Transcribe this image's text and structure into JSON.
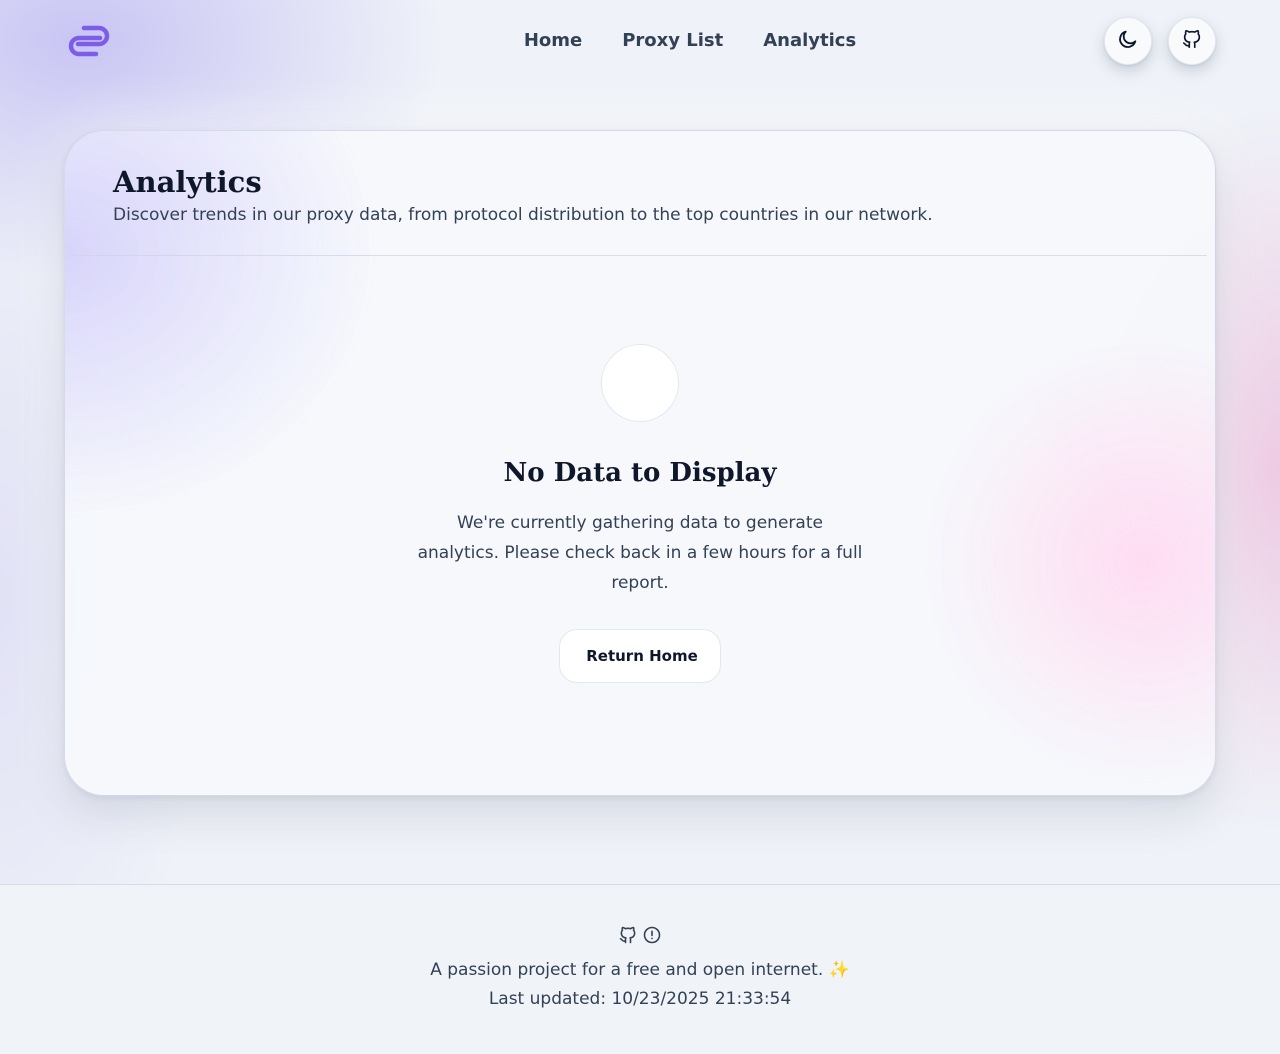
{
  "nav": {
    "links": [
      {
        "label": "Home"
      },
      {
        "label": "Proxy List"
      },
      {
        "label": "Analytics"
      }
    ]
  },
  "icons": {
    "logo": "link-logo-icon",
    "theme_toggle": "moon-icon",
    "github": "github-icon",
    "footer_github": "github-icon",
    "footer_issue": "alert-circle-icon"
  },
  "card": {
    "title": "Analytics",
    "subtitle": "Discover trends in our proxy data, from protocol distribution to the top countries in our network."
  },
  "empty_state": {
    "title": "No Data to Display",
    "message": "We're currently gathering data to generate analytics. Please check back in a few hours for a full report.",
    "button_label": "Return Home"
  },
  "footer": {
    "tagline": "A passion project for a free and open internet. ✨",
    "updated": "Last updated: 10/23/2025 21:33:54"
  },
  "colors": {
    "brand": "#7c5ce8",
    "text": "#334155",
    "heading": "#0f172a",
    "background": "#eff2f8"
  }
}
